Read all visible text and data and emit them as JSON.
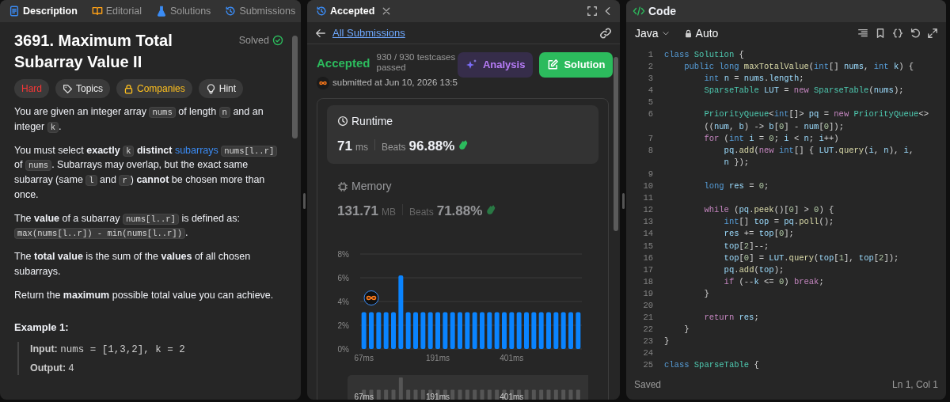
{
  "description_panel": {
    "tabs": [
      {
        "label": "Description",
        "selected": true
      },
      {
        "label": "Editorial",
        "selected": false
      },
      {
        "label": "Solutions",
        "selected": false
      },
      {
        "label": "Submissions",
        "selected": false
      }
    ],
    "title": "3691. Maximum Total Subarray Value II",
    "status": "Solved",
    "tags": [
      {
        "label": "Hard",
        "kind": "difficulty"
      },
      {
        "label": "Topics",
        "kind": "topics"
      },
      {
        "label": "Companies",
        "kind": "companies"
      },
      {
        "label": "Hint",
        "kind": "hint"
      }
    ],
    "paragraphs": [
      [
        {
          "kind": "text",
          "text": "You are given an integer array "
        },
        {
          "kind": "code",
          "text": "nums"
        },
        {
          "kind": "text",
          "text": " of length "
        },
        {
          "kind": "code",
          "text": "n"
        },
        {
          "kind": "text",
          "text": " and an integer "
        },
        {
          "kind": "code",
          "text": "k"
        },
        {
          "kind": "text",
          "text": "."
        }
      ],
      [
        {
          "kind": "text",
          "text": "You must select **exactly** "
        },
        {
          "kind": "code",
          "text": "k"
        },
        {
          "kind": "text",
          "text": " **distinct** "
        },
        {
          "kind": "link",
          "text": "subarrays "
        },
        {
          "kind": "code",
          "text": "nums[l..r]"
        },
        {
          "kind": "text",
          "text": " of "
        },
        {
          "kind": "code",
          "text": "nums"
        },
        {
          "kind": "text",
          "text": ". Subarrays may overlap, but the exact same subarray (same "
        },
        {
          "kind": "code",
          "text": "l"
        },
        {
          "kind": "text",
          "text": " and "
        },
        {
          "kind": "code",
          "text": "r"
        },
        {
          "kind": "text",
          "text": ") **cannot** be chosen more than once."
        }
      ],
      [
        {
          "kind": "text",
          "text": "The **value** of a subarray "
        },
        {
          "kind": "code",
          "text": "nums[l..r]"
        },
        {
          "kind": "text",
          "text": " is defined as: "
        },
        {
          "kind": "code",
          "text": "max(nums[l..r]) - min(nums[l..r])"
        },
        {
          "kind": "text",
          "text": "."
        }
      ],
      [
        {
          "kind": "text",
          "text": "The **total value** is the sum of the **values** of all chosen subarrays."
        }
      ],
      [
        {
          "kind": "text",
          "text": "Return the **maximum** possible total value you can achieve."
        }
      ]
    ],
    "example": {
      "heading": "Example 1:",
      "input_label": "Input:",
      "input": "nums = [1,3,2], k = 2",
      "output_label": "Output:",
      "output": "4"
    }
  },
  "submission_panel": {
    "tab": "Accepted",
    "back_link": "All Submissions",
    "verdict": "Accepted",
    "testcases": "930 / 930 testcases passed",
    "submitted": "submitted at Jun 10, 2026 13:5",
    "buttons": [
      {
        "label": "Analysis",
        "kind": "analysis"
      },
      {
        "label": "Solution",
        "kind": "solution"
      }
    ],
    "metrics": [
      {
        "label": "Runtime",
        "value": "71",
        "unit": "ms",
        "beats_label": "Beats",
        "beats": "96.88%",
        "selected": true
      },
      {
        "label": "Memory",
        "value": "131.71",
        "unit": "MB",
        "beats_label": "Beats",
        "beats": "71.88%",
        "selected": false
      }
    ],
    "chart_data": {
      "type": "bar",
      "categories": [
        "67ms",
        null,
        null,
        null,
        null,
        null,
        null,
        null,
        null,
        null,
        "191ms",
        null,
        null,
        null,
        null,
        null,
        null,
        null,
        null,
        null,
        "401ms",
        null,
        null,
        null,
        null,
        null,
        null,
        null,
        null,
        null
      ],
      "values": [
        3.1,
        3.1,
        3.1,
        3.1,
        3.1,
        6.2,
        3.1,
        3.1,
        3.1,
        3.1,
        3.1,
        3.1,
        3.1,
        3.1,
        3.1,
        3.1,
        3.1,
        3.1,
        3.1,
        3.1,
        3.1,
        3.1,
        3.1,
        3.1,
        3.1,
        3.1,
        3.1,
        3.1,
        3.1,
        3.1
      ],
      "ylim": [
        0,
        8
      ],
      "yticks": [
        {
          "value": 0,
          "label": "0%"
        },
        {
          "value": 2,
          "label": "2%"
        },
        {
          "value": 4,
          "label": "4%"
        },
        {
          "value": 6,
          "label": "6%"
        },
        {
          "value": 8,
          "label": "8%"
        }
      ],
      "grid": true
    },
    "overview_labels": [
      "67ms",
      "191ms",
      "401ms"
    ]
  },
  "code_panel": {
    "title": "Code",
    "language": "Java",
    "mode": "Auto",
    "lines": [
      {
        "number": "1",
        "segments": [
          {
            "text": "class ",
            "kind": "kw"
          },
          {
            "text": "Solution ",
            "kind": "type"
          },
          {
            "text": "{",
            "kind": "plain"
          }
        ]
      },
      {
        "number": "2",
        "segments": [
          {
            "text": "    public long ",
            "kind": "kw"
          },
          {
            "text": "maxTotalValue",
            "kind": "fn"
          },
          {
            "text": "(",
            "kind": "plain"
          },
          {
            "text": "int",
            "kind": "kw"
          },
          {
            "text": "[] ",
            "kind": "plain"
          },
          {
            "text": "nums",
            "kind": "var"
          },
          {
            "text": ", ",
            "kind": "plain"
          },
          {
            "text": "int ",
            "kind": "kw"
          },
          {
            "text": "k",
            "kind": "var"
          },
          {
            "text": ") {",
            "kind": "plain"
          }
        ]
      },
      {
        "number": "3",
        "segments": [
          {
            "text": "        int ",
            "kind": "kw"
          },
          {
            "text": "n",
            "kind": "var"
          },
          {
            "text": " = ",
            "kind": "plain"
          },
          {
            "text": "nums",
            "kind": "var"
          },
          {
            "text": ".",
            "kind": "plain"
          },
          {
            "text": "length",
            "kind": "var"
          },
          {
            "text": ";",
            "kind": "plain"
          }
        ]
      },
      {
        "number": "4",
        "segments": [
          {
            "text": "        SparseTable ",
            "kind": "type"
          },
          {
            "text": "LUT",
            "kind": "var"
          },
          {
            "text": " = ",
            "kind": "plain"
          },
          {
            "text": "new ",
            "kind": "ctl"
          },
          {
            "text": "SparseTable",
            "kind": "type"
          },
          {
            "text": "(",
            "kind": "plain"
          },
          {
            "text": "nums",
            "kind": "var"
          },
          {
            "text": ");",
            "kind": "plain"
          }
        ]
      },
      {
        "number": "5"
      },
      {
        "number": "6",
        "segments": [
          {
            "text": "        PriorityQueue",
            "kind": "type"
          },
          {
            "text": "<",
            "kind": "plain"
          },
          {
            "text": "int",
            "kind": "kw"
          },
          {
            "text": "[]> ",
            "kind": "plain"
          },
          {
            "text": "pq",
            "kind": "var"
          },
          {
            "text": " = ",
            "kind": "plain"
          },
          {
            "text": "new ",
            "kind": "ctl"
          },
          {
            "text": "PriorityQueue",
            "kind": "type"
          },
          {
            "text": "<>",
            "kind": "plain"
          }
        ],
        "wrap": [
          {
            "text": "        ((",
            "kind": "plain"
          },
          {
            "text": "num",
            "kind": "var"
          },
          {
            "text": ", ",
            "kind": "plain"
          },
          {
            "text": "b",
            "kind": "var"
          },
          {
            "text": ") -> ",
            "kind": "plain"
          },
          {
            "text": "b",
            "kind": "var"
          },
          {
            "text": "[",
            "kind": "plain"
          },
          {
            "text": "0",
            "kind": "num"
          },
          {
            "text": "] - ",
            "kind": "plain"
          },
          {
            "text": "num",
            "kind": "var"
          },
          {
            "text": "[",
            "kind": "plain"
          },
          {
            "text": "0",
            "kind": "num"
          },
          {
            "text": "]);",
            "kind": "plain"
          }
        ]
      },
      {
        "number": "7",
        "segments": [
          {
            "text": "        for",
            "kind": "ctl"
          },
          {
            "text": " (",
            "kind": "plain"
          },
          {
            "text": "int ",
            "kind": "kw"
          },
          {
            "text": "i",
            "kind": "var"
          },
          {
            "text": " = ",
            "kind": "plain"
          },
          {
            "text": "0",
            "kind": "num"
          },
          {
            "text": "; ",
            "kind": "plain"
          },
          {
            "text": "i",
            "kind": "var"
          },
          {
            "text": " < ",
            "kind": "plain"
          },
          {
            "text": "n",
            "kind": "var"
          },
          {
            "text": "; ",
            "kind": "plain"
          },
          {
            "text": "i",
            "kind": "var"
          },
          {
            "text": "++)",
            "kind": "plain"
          }
        ]
      },
      {
        "number": "8",
        "segments": [
          {
            "text": "            pq",
            "kind": "var"
          },
          {
            "text": ".",
            "kind": "plain"
          },
          {
            "text": "add",
            "kind": "fn"
          },
          {
            "text": "(",
            "kind": "plain"
          },
          {
            "text": "new ",
            "kind": "ctl"
          },
          {
            "text": "int",
            "kind": "kw"
          },
          {
            "text": "[] { ",
            "kind": "plain"
          },
          {
            "text": "LUT",
            "kind": "var"
          },
          {
            "text": ".",
            "kind": "plain"
          },
          {
            "text": "query",
            "kind": "fn"
          },
          {
            "text": "(",
            "kind": "plain"
          },
          {
            "text": "i",
            "kind": "var"
          },
          {
            "text": ", ",
            "kind": "plain"
          },
          {
            "text": "n",
            "kind": "var"
          },
          {
            "text": "), ",
            "kind": "plain"
          },
          {
            "text": "i",
            "kind": "var"
          },
          {
            "text": ",",
            "kind": "plain"
          }
        ],
        "wrap": [
          {
            "text": "            n",
            "kind": "var"
          },
          {
            "text": " });",
            "kind": "plain"
          }
        ]
      },
      {
        "number": "9"
      },
      {
        "number": "10",
        "segments": [
          {
            "text": "        long ",
            "kind": "kw"
          },
          {
            "text": "res",
            "kind": "var"
          },
          {
            "text": " = ",
            "kind": "plain"
          },
          {
            "text": "0",
            "kind": "num"
          },
          {
            "text": ";",
            "kind": "plain"
          }
        ]
      },
      {
        "number": "11"
      },
      {
        "number": "12",
        "segments": [
          {
            "text": "        while",
            "kind": "ctl"
          },
          {
            "text": " (",
            "kind": "plain"
          },
          {
            "text": "pq",
            "kind": "var"
          },
          {
            "text": ".",
            "kind": "plain"
          },
          {
            "text": "peek",
            "kind": "fn"
          },
          {
            "text": "()[",
            "kind": "plain"
          },
          {
            "text": "0",
            "kind": "num"
          },
          {
            "text": "] > ",
            "kind": "plain"
          },
          {
            "text": "0",
            "kind": "num"
          },
          {
            "text": ") {",
            "kind": "plain"
          }
        ]
      },
      {
        "number": "13",
        "segments": [
          {
            "text": "            int",
            "kind": "kw"
          },
          {
            "text": "[] ",
            "kind": "plain"
          },
          {
            "text": "top",
            "kind": "var"
          },
          {
            "text": " = ",
            "kind": "plain"
          },
          {
            "text": "pq",
            "kind": "var"
          },
          {
            "text": ".",
            "kind": "plain"
          },
          {
            "text": "poll",
            "kind": "fn"
          },
          {
            "text": "();",
            "kind": "plain"
          }
        ]
      },
      {
        "number": "14",
        "segments": [
          {
            "text": "            res",
            "kind": "var"
          },
          {
            "text": " += ",
            "kind": "plain"
          },
          {
            "text": "top",
            "kind": "var"
          },
          {
            "text": "[",
            "kind": "plain"
          },
          {
            "text": "0",
            "kind": "num"
          },
          {
            "text": "];",
            "kind": "plain"
          }
        ]
      },
      {
        "number": "15",
        "segments": [
          {
            "text": "            top",
            "kind": "var"
          },
          {
            "text": "[",
            "kind": "plain"
          },
          {
            "text": "2",
            "kind": "num"
          },
          {
            "text": "]--;",
            "kind": "plain"
          }
        ]
      },
      {
        "number": "16",
        "segments": [
          {
            "text": "            top",
            "kind": "var"
          },
          {
            "text": "[",
            "kind": "plain"
          },
          {
            "text": "0",
            "kind": "num"
          },
          {
            "text": "] = ",
            "kind": "plain"
          },
          {
            "text": "LUT",
            "kind": "var"
          },
          {
            "text": ".",
            "kind": "plain"
          },
          {
            "text": "query",
            "kind": "fn"
          },
          {
            "text": "(",
            "kind": "plain"
          },
          {
            "text": "top",
            "kind": "var"
          },
          {
            "text": "[",
            "kind": "plain"
          },
          {
            "text": "1",
            "kind": "num"
          },
          {
            "text": "], ",
            "kind": "plain"
          },
          {
            "text": "top",
            "kind": "var"
          },
          {
            "text": "[",
            "kind": "plain"
          },
          {
            "text": "2",
            "kind": "num"
          },
          {
            "text": "]);",
            "kind": "plain"
          }
        ]
      },
      {
        "number": "17",
        "segments": [
          {
            "text": "            pq",
            "kind": "var"
          },
          {
            "text": ".",
            "kind": "plain"
          },
          {
            "text": "add",
            "kind": "fn"
          },
          {
            "text": "(",
            "kind": "plain"
          },
          {
            "text": "top",
            "kind": "var"
          },
          {
            "text": ");",
            "kind": "plain"
          }
        ]
      },
      {
        "number": "18",
        "segments": [
          {
            "text": "            if",
            "kind": "ctl"
          },
          {
            "text": " (--",
            "kind": "plain"
          },
          {
            "text": "k",
            "kind": "var"
          },
          {
            "text": " <= ",
            "kind": "plain"
          },
          {
            "text": "0",
            "kind": "num"
          },
          {
            "text": ") ",
            "kind": "plain"
          },
          {
            "text": "break",
            "kind": "ctl"
          },
          {
            "text": ";",
            "kind": "plain"
          }
        ]
      },
      {
        "number": "19",
        "segments": [
          {
            "text": "        }",
            "kind": "plain"
          }
        ]
      },
      {
        "number": "20"
      },
      {
        "number": "21",
        "segments": [
          {
            "text": "        return ",
            "kind": "ctl"
          },
          {
            "text": "res",
            "kind": "var"
          },
          {
            "text": ";",
            "kind": "plain"
          }
        ]
      },
      {
        "number": "22",
        "segments": [
          {
            "text": "    }",
            "kind": "plain"
          }
        ]
      },
      {
        "number": "23",
        "segments": [
          {
            "text": "}",
            "kind": "plain"
          }
        ]
      },
      {
        "number": "24"
      },
      {
        "number": "25",
        "segments": [
          {
            "text": "class ",
            "kind": "kw"
          },
          {
            "text": "SparseTable ",
            "kind": "type"
          },
          {
            "text": "{",
            "kind": "plain"
          }
        ]
      }
    ],
    "status": "Saved",
    "cursor": "Ln 1, Col 1"
  }
}
